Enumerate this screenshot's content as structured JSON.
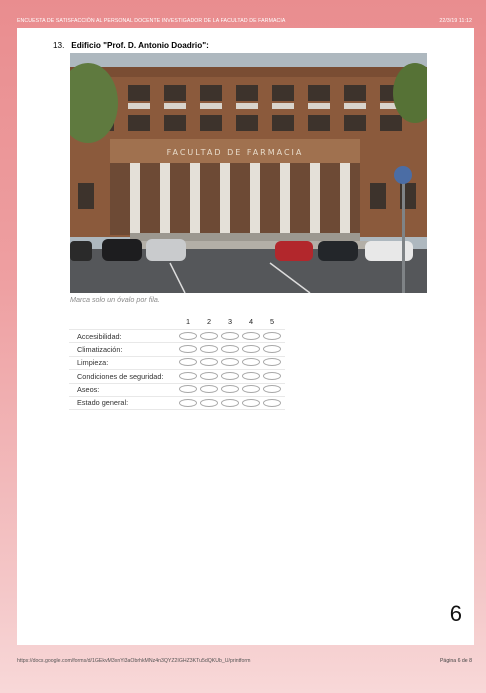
{
  "header": {
    "title": "ENCUESTA DE SATISFACCIÓN AL PERSONAL DOCENTE INVESTIGADOR DE LA FACULTAD DE FARMACIA",
    "datetime": "22/3/19 11:12"
  },
  "question": {
    "number": "13.",
    "title": "Edificio \"Prof. D. Antonio Doadrio\":",
    "photo_sign": "FACULTAD DE FARMACIA",
    "note": "Marca solo un óvalo por fila."
  },
  "grid": {
    "columns": [
      "1",
      "2",
      "3",
      "4",
      "5"
    ],
    "rows": [
      "Accesibilidad:",
      "Climatización:",
      "Limpieza:",
      "Condiciones de seguridad:",
      "Aseos:",
      "Estado general:"
    ]
  },
  "page_number": "6",
  "footer": {
    "url": "https://docs.google.com/forms/d/1GEkvM3xnYi3aObrhkMNz4n3QYZ2IGHZ3KTu5dQKUb_U/printform",
    "page": "Página 6 de 8"
  }
}
